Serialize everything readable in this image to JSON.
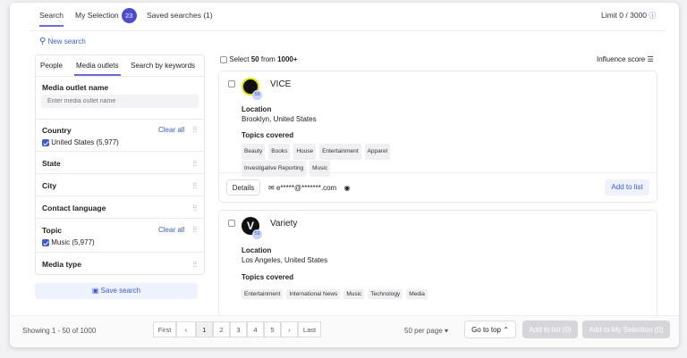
{
  "tabs": {
    "search": "Search",
    "my_selection": "My Selection",
    "my_selection_count": "23",
    "saved_searches": "Saved searches (1)",
    "limit": "Limit 0 / 3000"
  },
  "new_search": "New search",
  "filter_tabs": {
    "people": "People",
    "media_outlets": "Media outlets",
    "keywords": "Search by keywords"
  },
  "outlet_name": {
    "label": "Media outlet name",
    "placeholder": "Enter media outlet name"
  },
  "country": {
    "label": "Country",
    "clear": "Clear all",
    "value": "United States (5,977)"
  },
  "state": "State",
  "city": "City",
  "contact_language": "Contact language",
  "topic": {
    "label": "Topic",
    "clear": "Clear all",
    "value": "Music (5,977)"
  },
  "media_type": "Media type",
  "save_search": "Save search",
  "results_header": {
    "select_prefix": "Select",
    "select_count": "50",
    "select_mid": "from",
    "select_total": "1000+",
    "sort": "Influence score"
  },
  "results": [
    {
      "name": "VICE",
      "score": "59",
      "location_label": "Location",
      "location": "Brooklyn, United States",
      "topics_label": "Topics covered",
      "topics": [
        "Beauty",
        "Books",
        "House",
        "Entertainment",
        "Apparel",
        "Investigative Reporting",
        "Music"
      ],
      "details": "Details",
      "email": "e*****@*******.com",
      "add": "Add to list"
    },
    {
      "name": "Variety",
      "score": "59",
      "location_label": "Location",
      "location": "Los Angeles, United States",
      "topics_label": "Topics covered",
      "topics": [
        "Entertainment",
        "International News",
        "Music",
        "Technology",
        "Media"
      ]
    }
  ],
  "footer": {
    "showing": "Showing 1 - 50 of 1000",
    "first": "First",
    "prev": "‹",
    "pages": [
      "1",
      "2",
      "3",
      "4",
      "5"
    ],
    "next": "›",
    "last": "Last",
    "per_page": "50 per page",
    "go_top": "Go to top",
    "add_list": "Add to list (0)",
    "add_selection": "Add to My Selection (0)"
  },
  "colors": {
    "accent": "#4c4cd3",
    "link": "#3b5bd6"
  }
}
